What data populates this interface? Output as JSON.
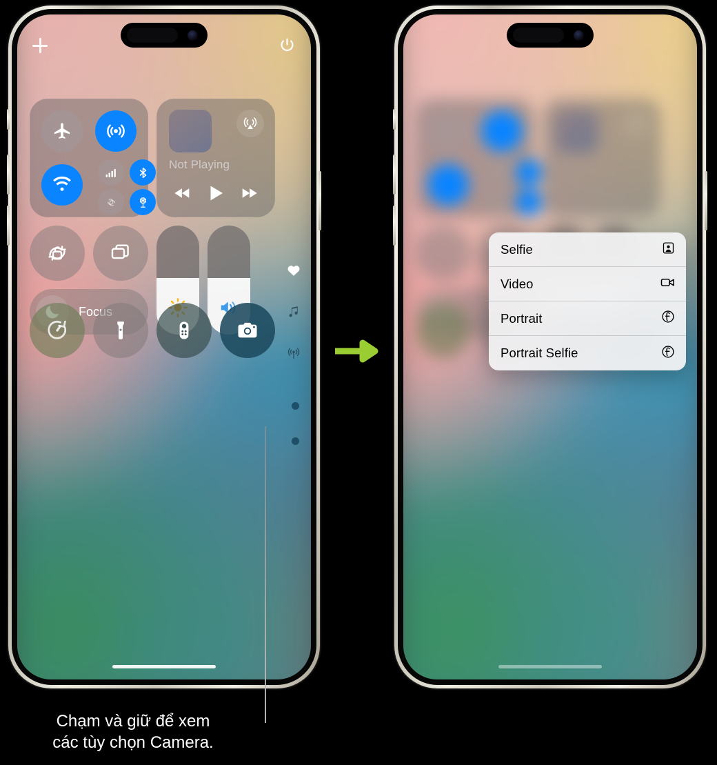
{
  "caption": {
    "line1": "Chạm và giữ để xem",
    "line2": "các tùy chọn Camera."
  },
  "arrow": {
    "name": "right-arrow",
    "color": "#9acd32"
  },
  "phones": {
    "left": {
      "label": "Control Center screen"
    },
    "right": {
      "label": "Control Center with Camera options menu"
    }
  },
  "control_center": {
    "top_bar": {
      "add_label": "+",
      "power_label": "power"
    },
    "connectivity": {
      "airplane_mode": {
        "label": "Airplane Mode",
        "state": "off"
      },
      "airdrop_antenna": {
        "label": "AirDrop",
        "state": "on"
      },
      "wifi": {
        "label": "Wi-Fi",
        "state": "on"
      },
      "cellular": {
        "label": "Cellular Data",
        "state": "off"
      },
      "bluetooth": {
        "label": "Bluetooth",
        "state": "on"
      },
      "airdrop": {
        "label": "AirDrop",
        "state": "off"
      },
      "hotspot": {
        "label": "Personal Hotspot",
        "state": "on"
      }
    },
    "media": {
      "title": "Not Playing",
      "airplay_label": "AirPlay",
      "rewind_label": "Rewind",
      "play_label": "Play",
      "forward_label": "Fast Forward"
    },
    "toggles": {
      "rotation_lock": "Rotation Lock",
      "screen_mirroring": "Screen Mirroring",
      "focus": "Focus"
    },
    "sliders": {
      "brightness_label": "Brightness",
      "brightness_value": 52,
      "volume_label": "Volume",
      "volume_value": 52
    },
    "rail_icons": [
      "heart-icon",
      "music-note-icon",
      "hearing-icon"
    ],
    "bottom_row": {
      "timer": "Timer",
      "flashlight": "Flashlight",
      "remote": "Apple TV Remote",
      "camera": "Camera"
    },
    "page_dots": 2
  },
  "camera_menu": {
    "items": [
      {
        "label": "Selfie",
        "icon": "selfie-icon"
      },
      {
        "label": "Video",
        "icon": "video-icon"
      },
      {
        "label": "Portrait",
        "icon": "aperture-icon"
      },
      {
        "label": "Portrait Selfie",
        "icon": "aperture-icon"
      }
    ]
  },
  "colors": {
    "accent_blue": "#0a84ff",
    "arrow_green": "#9acd32",
    "menu_bg": "#f2f2f3"
  }
}
